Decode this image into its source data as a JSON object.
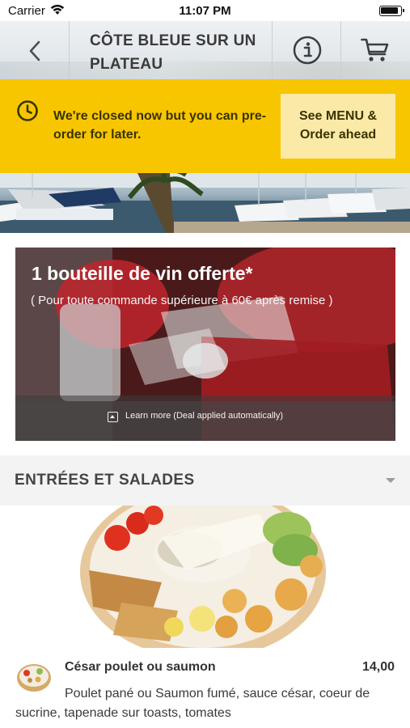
{
  "status_bar": {
    "carrier": "Carrier",
    "time": "11:07 PM"
  },
  "header": {
    "title": "CÔTE BLEUE SUR UN PLATEAU",
    "back_icon": "chevron-left-icon",
    "info_icon": "info-icon",
    "cart_icon": "cart-icon"
  },
  "banner": {
    "message": "We're closed now but you can pre-order for later.",
    "button_label": "See MENU & Order ahead",
    "background_color": "#f7c600"
  },
  "promo": {
    "title": "1 bouteille de vin offerte*",
    "subtitle": "( Pour toute commande supérieure à 60€ après remise )",
    "footer_text": "Learn more (Deal applied automatically)"
  },
  "section": {
    "title": "ENTRÉES ET SALADES"
  },
  "dish": {
    "name": "César poulet ou saumon",
    "price": "14,00",
    "description": "Poulet pané ou Saumon fumé, sauce césar, coeur de sucrine, tapenade sur toasts, tomates"
  }
}
